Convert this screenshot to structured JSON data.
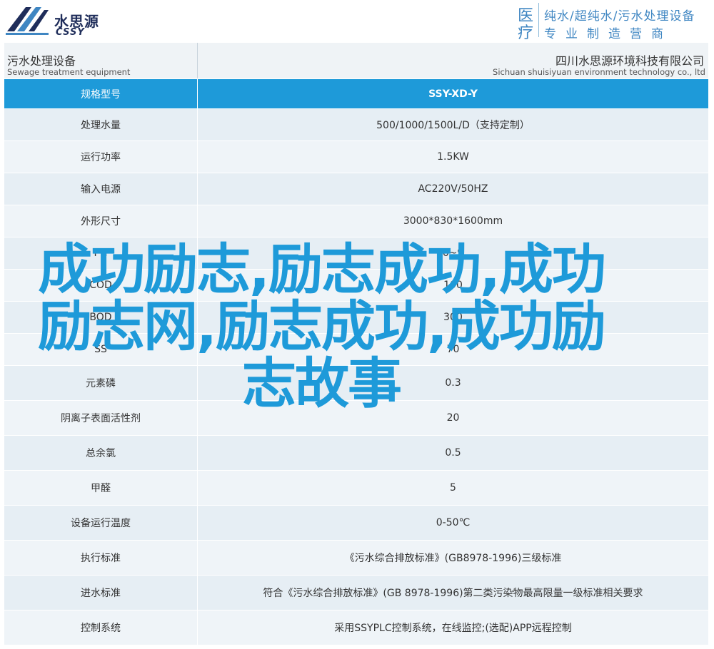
{
  "header": {
    "logo_cn": "水思源",
    "logo_en": "CSSY",
    "yi_1": "医",
    "yi_2": "疗",
    "slogan_1": "纯水/超纯水/污水处理设备",
    "slogan_2": "专业制造营商"
  },
  "band": {
    "left_cn": "污水处理设备",
    "left_en": "Sewage treatment equipment",
    "right_cn": "四川水思源环境科技有限公司",
    "right_en": "Sichuan shuisiyuan environment technology co., ltd"
  },
  "table": {
    "header": {
      "label": "规格型号",
      "value": "SSY-XD-Y"
    },
    "rows": [
      {
        "label": "处理水量",
        "value": "500/1000/1500L/D（支持定制）"
      },
      {
        "label": "运行功率",
        "value": "1.5KW"
      },
      {
        "label": "输入电源",
        "value": "AC220V/50HZ"
      },
      {
        "label": "外形尺寸",
        "value": "3000*830*1600mm"
      },
      {
        "label": "PH",
        "value": "6~9"
      },
      {
        "label": "COD",
        "value": "100"
      },
      {
        "label": "BOD",
        "value": "300"
      },
      {
        "label": "SS",
        "value": "70"
      },
      {
        "label": "元素磷",
        "value": "0.3"
      },
      {
        "label": "阴离子表面活性剂",
        "value": "20"
      },
      {
        "label": "总余氯",
        "value": "0.5"
      },
      {
        "label": "甲醛",
        "value": "5"
      },
      {
        "label": "设备运行温度",
        "value": "0-50℃"
      },
      {
        "label": "执行标准",
        "value": "《污水综合排放标准》(GB8978-1996)三级标准"
      },
      {
        "label": "进水标准",
        "value": "符合《污水综合排放标准》(GB 8978-1996)第二类污染物最高限量一级标准相关要求"
      },
      {
        "label": "控制系统",
        "value": "采用SSYPLC控制系统，在线监控;(选配)APP远程控制"
      }
    ]
  },
  "overlay": {
    "line_1": "成功励志,励志成功,成功",
    "line_2": "励志网,励志成功,成功励",
    "line_3": "志故事"
  },
  "colors": {
    "accent": "#1e9ad9",
    "brand_dark": "#1f2d5a",
    "slogan": "#3f86c2"
  }
}
